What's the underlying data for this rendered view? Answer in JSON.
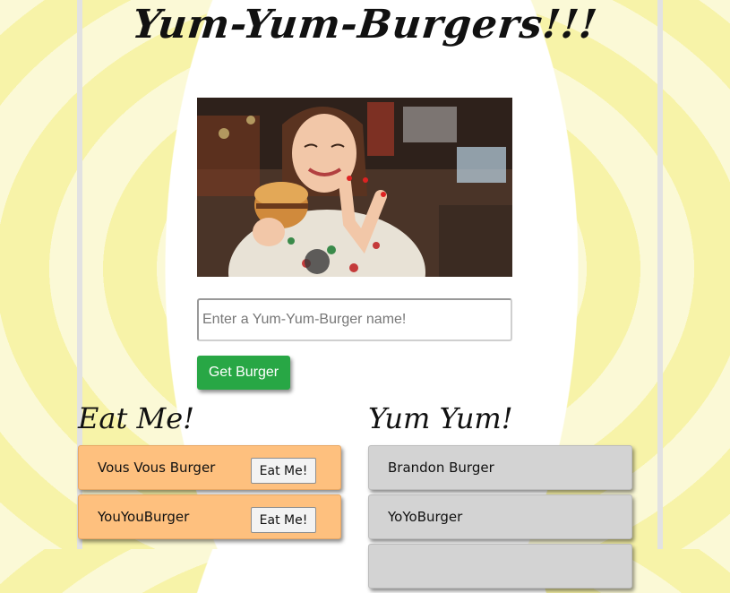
{
  "header": {
    "title": "Yum-Yum-Burgers!!!"
  },
  "hero": {
    "alt": "Woman eating a burger"
  },
  "form": {
    "placeholder": "Enter a Yum-Yum-Burger name!",
    "submit_label": "Get Burger"
  },
  "eat_me": {
    "heading": "Eat Me!",
    "button_label": "Eat Me!",
    "items": [
      {
        "name": "Vous Vous Burger"
      },
      {
        "name": "YouYouBurger"
      }
    ]
  },
  "yum_yum": {
    "heading": "Yum Yum!",
    "items": [
      {
        "name": "Brandon Burger"
      },
      {
        "name": "YoYoBurger"
      },
      {
        "name": ""
      }
    ]
  },
  "colors": {
    "primary_button": "#28a745",
    "eat_item_bg": "#fec07e",
    "yum_item_bg": "#d3d3d3",
    "background_stripe_light": "#fbf9d6",
    "background_stripe_dark": "#f7f3a8"
  }
}
